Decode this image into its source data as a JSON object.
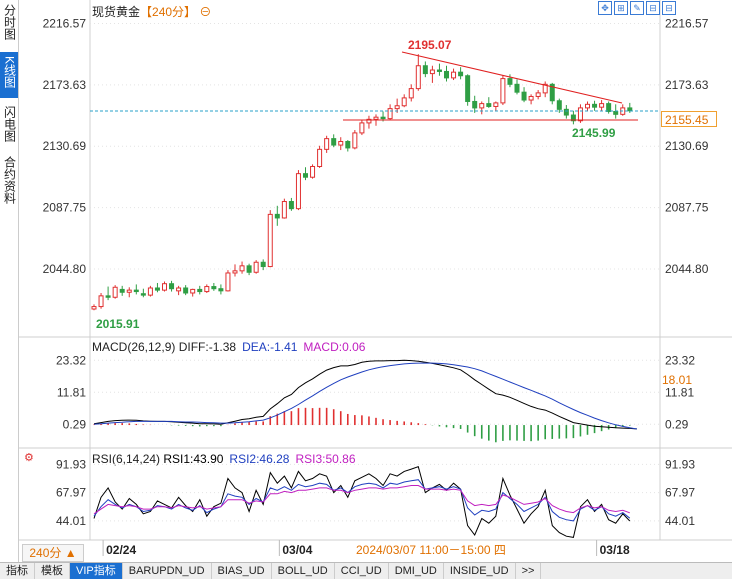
{
  "sidebar": {
    "tabs": [
      {
        "label": "分时图"
      },
      {
        "label": "K线图"
      },
      {
        "label": "闪电图"
      },
      {
        "label": "合约资料"
      }
    ]
  },
  "header": {
    "title": "现货黄金",
    "period": "【240分】",
    "settings_glyph": "⊖"
  },
  "toolbar": {
    "icons": [
      "move-icon",
      "zoom-in-icon",
      "draw-icon",
      "zoom-out-icon",
      "zoom-out-2-icon"
    ]
  },
  "price_tag": "2155.45",
  "macd_tag": "18.01",
  "period_selector": "240分 ▲",
  "bottom_tabs": [
    "指标",
    "模板",
    "VIP指标",
    "BARUPDN_UD",
    "BIAS_UD",
    "BOLL_UD",
    "CCI_UD",
    "DMI_UD",
    "INSIDE_UD",
    ">>"
  ],
  "colors": {
    "up": "#e03030",
    "down": "#2f9e44",
    "accent": "#1a6fd1",
    "orange": "#e07000",
    "macd_line": "#c020c0",
    "rsi1": "#000000",
    "rsi2": "#1f3fbf",
    "rsi3": "#c020c0"
  },
  "chart_data": [
    {
      "type": "candlestick",
      "title": "现货黄金 【240分】",
      "ylim": [
        2012,
        2226
      ],
      "yticks": [
        2216.57,
        2173.63,
        2130.69,
        2087.75,
        2044.8
      ],
      "xticks": [
        {
          "label": "02/24",
          "i": 2
        },
        {
          "label": "03/04",
          "i": 27
        },
        {
          "label": "03/18",
          "i": 72
        }
      ],
      "crosshair_label": "2024/03/07 11:00－15:00 四",
      "annotations": [
        {
          "label": "2015.91",
          "kind": "low"
        },
        {
          "label": "2195.07",
          "kind": "high"
        },
        {
          "label": "2145.99",
          "kind": "low2"
        }
      ],
      "last_price": 2155.45,
      "ohlc": [
        [
          2016.8,
          2020.0,
          2015.9,
          2018.5
        ],
        [
          2018.5,
          2028.0,
          2017.0,
          2026.0
        ],
        [
          2026.0,
          2032.5,
          2023.0,
          2025.0
        ],
        [
          2025.0,
          2033.5,
          2024.0,
          2032.0
        ],
        [
          2030.5,
          2033.0,
          2026.0,
          2028.5
        ],
        [
          2028.5,
          2032.0,
          2025.0,
          2030.0
        ],
        [
          2030.0,
          2034.0,
          2027.0,
          2029.0
        ],
        [
          2027.5,
          2031.0,
          2025.0,
          2026.5
        ],
        [
          2026.5,
          2033.0,
          2025.5,
          2031.5
        ],
        [
          2031.5,
          2035.0,
          2028.5,
          2030.0
        ],
        [
          2030.0,
          2036.0,
          2029.0,
          2034.5
        ],
        [
          2034.5,
          2036.5,
          2029.0,
          2031.0
        ],
        [
          2029.5,
          2033.0,
          2026.5,
          2031.5
        ],
        [
          2031.5,
          2033.5,
          2026.5,
          2028.0
        ],
        [
          2028.0,
          2031.0,
          2025.5,
          2030.5
        ],
        [
          2030.5,
          2033.0,
          2027.0,
          2029.0
        ],
        [
          2029.0,
          2034.0,
          2028.0,
          2032.5
        ],
        [
          2032.5,
          2035.0,
          2029.5,
          2031.0
        ],
        [
          2031.0,
          2034.0,
          2027.0,
          2029.5
        ],
        [
          2029.5,
          2044.0,
          2029.0,
          2042.0
        ],
        [
          2042.0,
          2048.0,
          2039.5,
          2043.5
        ],
        [
          2043.5,
          2050.0,
          2041.5,
          2047.0
        ],
        [
          2047.0,
          2048.5,
          2040.5,
          2042.5
        ],
        [
          2042.5,
          2051.0,
          2041.5,
          2049.5
        ],
        [
          2049.5,
          2051.5,
          2044.0,
          2046.5
        ],
        [
          2046.5,
          2086.0,
          2046.0,
          2083.0
        ],
        [
          2083.0,
          2089.0,
          2075.0,
          2080.5
        ],
        [
          2080.5,
          2094.0,
          2080.0,
          2092.0
        ],
        [
          2092.0,
          2094.5,
          2085.5,
          2087.0
        ],
        [
          2087.0,
          2114.0,
          2086.0,
          2111.5
        ],
        [
          2111.5,
          2116.0,
          2107.0,
          2109.0
        ],
        [
          2109.0,
          2118.0,
          2108.0,
          2116.5
        ],
        [
          2116.5,
          2131.0,
          2115.5,
          2128.5
        ],
        [
          2128.5,
          2138.0,
          2126.0,
          2136.0
        ],
        [
          2136.0,
          2139.0,
          2130.0,
          2131.5
        ],
        [
          2131.5,
          2137.0,
          2128.0,
          2134.0
        ],
        [
          2134.0,
          2135.0,
          2127.0,
          2129.5
        ],
        [
          2129.5,
          2142.0,
          2128.5,
          2140.0
        ],
        [
          2140.0,
          2149.0,
          2138.5,
          2147.0
        ],
        [
          2147.0,
          2152.0,
          2143.0,
          2149.5
        ],
        [
          2149.5,
          2153.0,
          2145.0,
          2151.0
        ],
        [
          2151.0,
          2155.0,
          2148.0,
          2150.0
        ],
        [
          2150.0,
          2160.0,
          2149.0,
          2157.0
        ],
        [
          2157.0,
          2164.0,
          2154.0,
          2159.0
        ],
        [
          2159.0,
          2167.0,
          2158.0,
          2164.5
        ],
        [
          2164.5,
          2174.0,
          2162.0,
          2171.0
        ],
        [
          2171.0,
          2195.1,
          2169.5,
          2187.0
        ],
        [
          2187.0,
          2190.0,
          2179.0,
          2181.5
        ],
        [
          2181.5,
          2187.0,
          2175.0,
          2184.0
        ],
        [
          2184.0,
          2188.5,
          2180.0,
          2183.0
        ],
        [
          2183.0,
          2187.0,
          2176.0,
          2178.5
        ],
        [
          2178.5,
          2185.0,
          2177.0,
          2182.5
        ],
        [
          2182.5,
          2186.0,
          2177.5,
          2180.0
        ],
        [
          2180.0,
          2181.0,
          2159.0,
          2162.0
        ],
        [
          2162.0,
          2166.0,
          2154.0,
          2157.5
        ],
        [
          2157.5,
          2162.0,
          2153.0,
          2160.5
        ],
        [
          2160.5,
          2165.0,
          2157.5,
          2158.5
        ],
        [
          2158.5,
          2162.0,
          2155.5,
          2161.0
        ],
        [
          2161.0,
          2180.5,
          2159.5,
          2178.0
        ],
        [
          2178.0,
          2181.0,
          2172.0,
          2174.0
        ],
        [
          2174.0,
          2177.5,
          2167.0,
          2168.5
        ],
        [
          2168.5,
          2172.0,
          2161.5,
          2163.0
        ],
        [
          2163.0,
          2167.0,
          2160.0,
          2165.5
        ],
        [
          2165.5,
          2170.0,
          2163.5,
          2168.0
        ],
        [
          2168.0,
          2176.0,
          2165.0,
          2174.0
        ],
        [
          2174.0,
          2175.0,
          2160.0,
          2162.5
        ],
        [
          2162.5,
          2164.0,
          2154.0,
          2156.5
        ],
        [
          2156.5,
          2159.5,
          2150.0,
          2152.5
        ],
        [
          2152.5,
          2155.5,
          2146.0,
          2148.5
        ],
        [
          2148.5,
          2160.0,
          2147.0,
          2157.5
        ],
        [
          2157.5,
          2162.0,
          2155.0,
          2160.0
        ],
        [
          2160.0,
          2162.5,
          2155.5,
          2158.0
        ],
        [
          2158.0,
          2163.0,
          2155.0,
          2160.5
        ],
        [
          2160.5,
          2162.0,
          2153.5,
          2155.0
        ],
        [
          2155.0,
          2160.0,
          2150.0,
          2153.0
        ],
        [
          2153.0,
          2160.0,
          2152.0,
          2157.5
        ],
        [
          2157.5,
          2161.0,
          2154.0,
          2155.5
        ]
      ]
    },
    {
      "type": "line",
      "title": "MACD(26,12,9)",
      "labels": [
        {
          "name": "DIFF",
          "value": "-1.38"
        },
        {
          "name": "DEA",
          "value": "-1.41"
        },
        {
          "name": "MACD",
          "value": "0.06"
        }
      ],
      "ylim": [
        -10,
        25
      ],
      "yticks": [
        23.32,
        11.81,
        0.29
      ],
      "series": [
        {
          "name": "DIFF",
          "values": [
            0.5,
            0.9,
            1.3,
            1.6,
            1.7,
            1.8,
            1.7,
            1.5,
            1.4,
            1.3,
            1.3,
            1.2,
            1.0,
            0.8,
            0.7,
            0.5,
            0.5,
            0.4,
            0.3,
            0.8,
            1.4,
            2.0,
            2.3,
            2.8,
            3.1,
            5.8,
            7.7,
            9.8,
            11.0,
            13.5,
            15.2,
            16.6,
            18.3,
            19.8,
            20.7,
            21.3,
            21.3,
            21.8,
            22.6,
            23.0,
            23.1,
            23.1,
            23.2,
            23.2,
            23.3,
            23.2,
            23.0,
            22.6,
            22.2,
            21.7,
            21.2,
            20.6,
            19.9,
            18.2,
            16.3,
            14.6,
            12.9,
            11.3,
            10.8,
            10.0,
            8.9,
            7.8,
            6.7,
            5.9,
            5.4,
            4.3,
            3.1,
            2.0,
            0.9,
            0.4,
            0.0,
            -0.4,
            -0.6,
            -0.8,
            -1.0,
            -1.1,
            -1.2,
            -1.38
          ]
        },
        {
          "name": "DEA",
          "values": [
            0.3,
            0.5,
            0.7,
            0.9,
            1.0,
            1.2,
            1.3,
            1.3,
            1.3,
            1.3,
            1.3,
            1.3,
            1.2,
            1.1,
            1.1,
            1.0,
            0.9,
            0.8,
            0.7,
            0.7,
            0.8,
            1.0,
            1.2,
            1.5,
            1.8,
            2.6,
            3.6,
            4.8,
            6.0,
            7.4,
            9.0,
            10.5,
            12.1,
            13.6,
            15.0,
            16.3,
            17.3,
            18.2,
            19.1,
            19.9,
            20.5,
            21.0,
            21.4,
            21.7,
            22.0,
            22.2,
            22.3,
            22.3,
            22.3,
            22.2,
            22.0,
            21.7,
            21.3,
            20.9,
            20.3,
            19.5,
            18.5,
            17.5,
            16.5,
            15.5,
            14.5,
            13.5,
            12.5,
            11.5,
            10.5,
            9.3,
            8.0,
            6.8,
            5.6,
            4.5,
            3.5,
            2.5,
            1.6,
            0.8,
            0.1,
            -0.5,
            -1.0,
            -1.41
          ]
        }
      ],
      "bars_name": "MACD"
    },
    {
      "type": "line",
      "title": "RSI(6,14,24)",
      "labels": [
        {
          "name": "RSI1",
          "value": "43.90"
        },
        {
          "name": "RSI2",
          "value": "46.28"
        },
        {
          "name": "RSI3",
          "value": "50.86"
        }
      ],
      "ylim": [
        35,
        96
      ],
      "yticks": [
        91.93,
        67.97,
        44.01
      ],
      "series": [
        {
          "name": "RSI1",
          "values": [
            46,
            64,
            72,
            60,
            54,
            63,
            58,
            50,
            52,
            61,
            58,
            55,
            64,
            57,
            52,
            62,
            48,
            56,
            59,
            80,
            72,
            68,
            52,
            70,
            58,
            85,
            76,
            82,
            72,
            86,
            78,
            80,
            84,
            82,
            68,
            74,
            64,
            78,
            81,
            84,
            80,
            74,
            84,
            82,
            86,
            88,
            90,
            68,
            72,
            75,
            70,
            76,
            71,
            40,
            32,
            46,
            42,
            48,
            80,
            66,
            54,
            42,
            50,
            56,
            70,
            40,
            34,
            31,
            30,
            56,
            62,
            52,
            58,
            45,
            42,
            50,
            43.9
          ]
        },
        {
          "name": "RSI2",
          "values": [
            48,
            56,
            62,
            58,
            55,
            58,
            56,
            52,
            53,
            57,
            56,
            54,
            58,
            55,
            53,
            57,
            51,
            54,
            56,
            67,
            65,
            64,
            58,
            63,
            60,
            72,
            70,
            73,
            70,
            75,
            73,
            74,
            76,
            75,
            70,
            72,
            68,
            73,
            75,
            76,
            75,
            72,
            76,
            75,
            77,
            78,
            79,
            71,
            72,
            73,
            71,
            73,
            71,
            55,
            49,
            53,
            52,
            54,
            68,
            63,
            58,
            52,
            55,
            58,
            64,
            52,
            47,
            45,
            44,
            54,
            57,
            53,
            56,
            50,
            48,
            51,
            46.28
          ]
        },
        {
          "name": "RSI3",
          "values": [
            50,
            54,
            58,
            57,
            56,
            57,
            56,
            54,
            54,
            56,
            56,
            55,
            57,
            56,
            55,
            56,
            54,
            55,
            56,
            62,
            62,
            62,
            59,
            61,
            60,
            67,
            67,
            69,
            68,
            70,
            70,
            71,
            72,
            72,
            70,
            70,
            68,
            70,
            71,
            72,
            72,
            71,
            72,
            72,
            73,
            74,
            74,
            71,
            71,
            71,
            70,
            71,
            70,
            61,
            57,
            58,
            57,
            58,
            66,
            64,
            61,
            58,
            59,
            60,
            63,
            57,
            54,
            52,
            51,
            55,
            57,
            55,
            56,
            53,
            52,
            53,
            50.86
          ]
        }
      ]
    }
  ]
}
